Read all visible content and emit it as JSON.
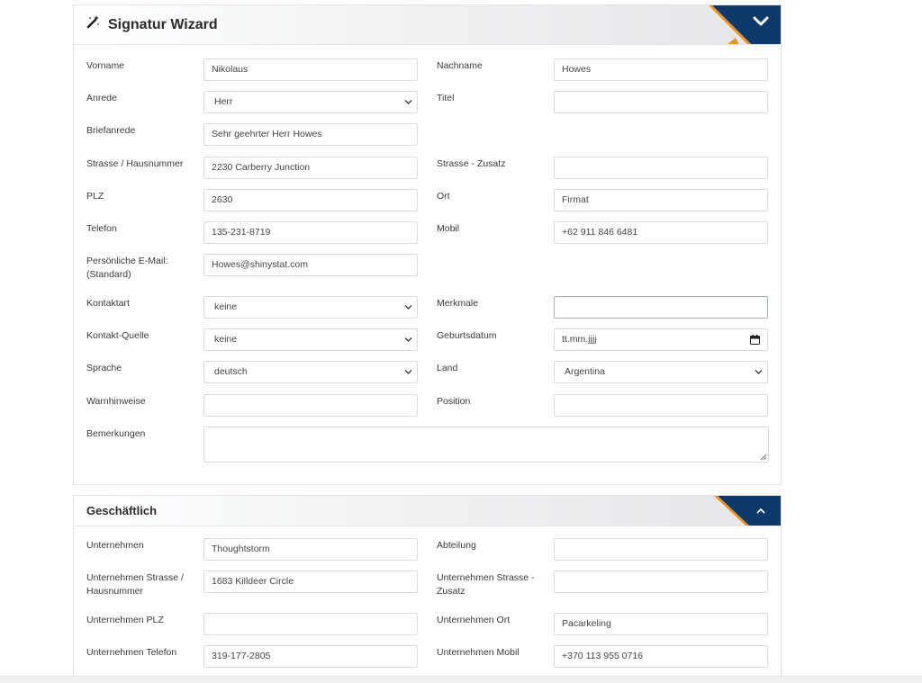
{
  "wizard": {
    "title": "Signatur Wizard",
    "fields": {
      "vorname": {
        "label": "Vorname",
        "value": "Nikolaus"
      },
      "nachname": {
        "label": "Nachname",
        "value": "Howes"
      },
      "anrede": {
        "label": "Anrede",
        "value": "Herr"
      },
      "titel": {
        "label": "Titel",
        "value": ""
      },
      "briefanrede": {
        "label": "Briefanrede",
        "value": "Sehr geehrter Herr Howes"
      },
      "strasse": {
        "label": "Strasse / Hausnummer",
        "value": "2230 Carberry Junction"
      },
      "strasse_zusatz": {
        "label": "Strasse - Zusatz",
        "value": ""
      },
      "plz": {
        "label": "PLZ",
        "value": "2630"
      },
      "ort": {
        "label": "Ort",
        "value": "Firmat"
      },
      "telefon": {
        "label": "Telefon",
        "value": "135-231-8719"
      },
      "mobil": {
        "label": "Mobil",
        "value": "+62 911 846 6481"
      },
      "email": {
        "label_line1": "Persönliche E-Mail:",
        "label_line2": "(Standard)",
        "value": "Howes@shinystat.com"
      },
      "kontaktart": {
        "label": "Kontaktart",
        "value": "keine"
      },
      "merkmale": {
        "label": "Merkmale",
        "value": ""
      },
      "kontakt_quelle": {
        "label": "Kontakt-Quelle",
        "value": "keine"
      },
      "geburtsdatum": {
        "label": "Geburtsdatum",
        "value": "tt.mm.jjjj"
      },
      "sprache": {
        "label": "Sprache",
        "value": "deutsch"
      },
      "land": {
        "label": "Land",
        "value": "Argentina"
      },
      "warnhinweise": {
        "label": "Warnhinweise",
        "value": ""
      },
      "position": {
        "label": "Position",
        "value": ""
      },
      "bemerkungen": {
        "label": "Bemerkungen",
        "value": ""
      }
    }
  },
  "business": {
    "title": "Geschäftlich",
    "fields": {
      "unternehmen": {
        "label": "Unternehmen",
        "value": "Thoughtstorm"
      },
      "abteilung": {
        "label": "Abteilung",
        "value": ""
      },
      "u_strasse": {
        "label_line1": "Unternehmen Strasse /",
        "label_line2": "Hausnummer",
        "value": "1683 Killdeer Circle"
      },
      "u_strasse_zusatz": {
        "label_line1": "Unternehmen Strasse -",
        "label_line2": "Zusatz",
        "value": ""
      },
      "u_plz": {
        "label": "Unternehmen PLZ",
        "value": ""
      },
      "u_ort": {
        "label": "Unternehmen Ort",
        "value": "Pacarkeling"
      },
      "u_telefon": {
        "label": "Unternehmen Telefon",
        "value": "319-177-2805"
      },
      "u_mobil": {
        "label": "Unternehmen Mobil",
        "value": "+370 113 955 0716"
      }
    }
  },
  "colors": {
    "navy": "#0d3a6b",
    "orange": "#f0911c",
    "border": "#d9dce1"
  },
  "icons": {
    "wizard_icon": "magic-wand-icon",
    "collapse_icon": "chevron-down-icon",
    "expand_icon": "chevron-up-icon",
    "select_icon": "chevron-down-icon",
    "date_icon": "calendar-icon"
  }
}
